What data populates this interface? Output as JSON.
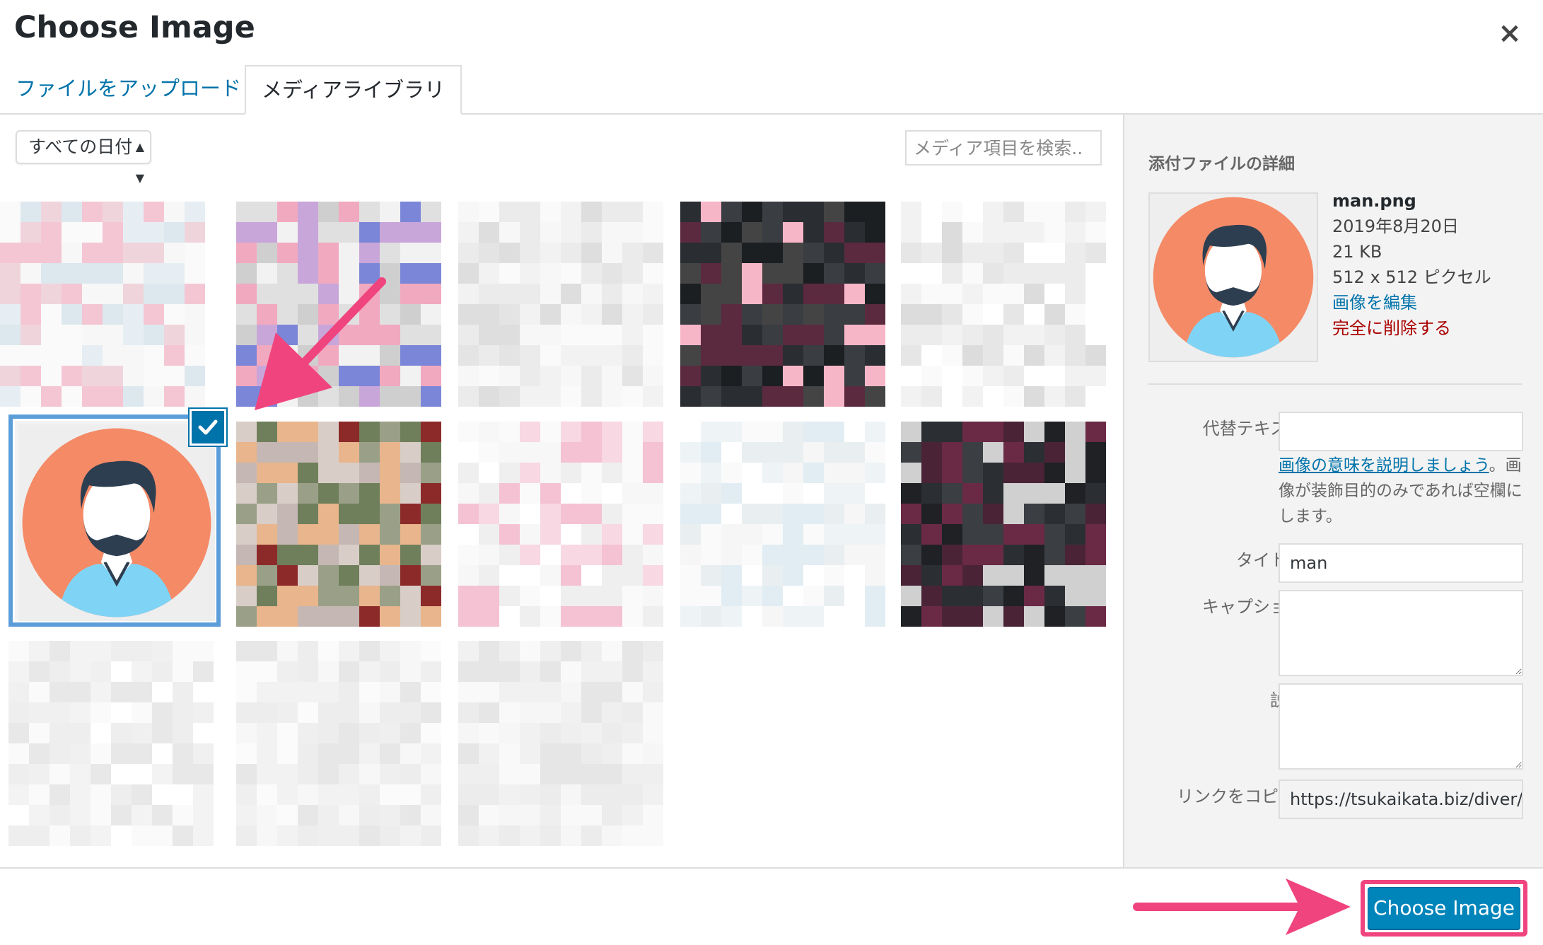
{
  "header": {
    "title": "Choose Image",
    "close_label": "×"
  },
  "tabs": [
    {
      "label": "ファイルをアップロード",
      "active": false
    },
    {
      "label": "メディアライブラリ",
      "active": true
    }
  ],
  "toolbar": {
    "date_filter": "すべての日付",
    "search_placeholder": "メディア項目を検索.."
  },
  "sidebar": {
    "heading": "添付ファイルの詳細",
    "file_name": "man.png",
    "date": "2019年8月20日",
    "size": "21 KB",
    "dimensions": "512 x 512 ピクセル",
    "edit_link": "画像を編集",
    "delete_link": "完全に削除する",
    "fields": {
      "alt_label": "代替テキスト",
      "alt_value": "",
      "alt_help_link": "画像の意味を説明しましょう",
      "alt_help_tail": "。画像が装飾目的のみであれば空欄にします。",
      "title_label": "タイトル",
      "title_value": "man",
      "caption_label": "キャプション",
      "caption_value": "",
      "description_label": "説明",
      "description_value": "",
      "copy_link_label": "リンクをコピー",
      "copy_link_value": "https://tsukaikata.biz/diver/"
    }
  },
  "footer": {
    "choose_button": "Choose Image"
  },
  "colors": {
    "accent": "#0073aa",
    "primary_button": "#0085ba",
    "annotation": "#f0447e",
    "delete": "#a00000",
    "avatar_bg": "#f58a67",
    "avatar_shirt": "#7fd4f6",
    "avatar_hair": "#2d3e50"
  }
}
